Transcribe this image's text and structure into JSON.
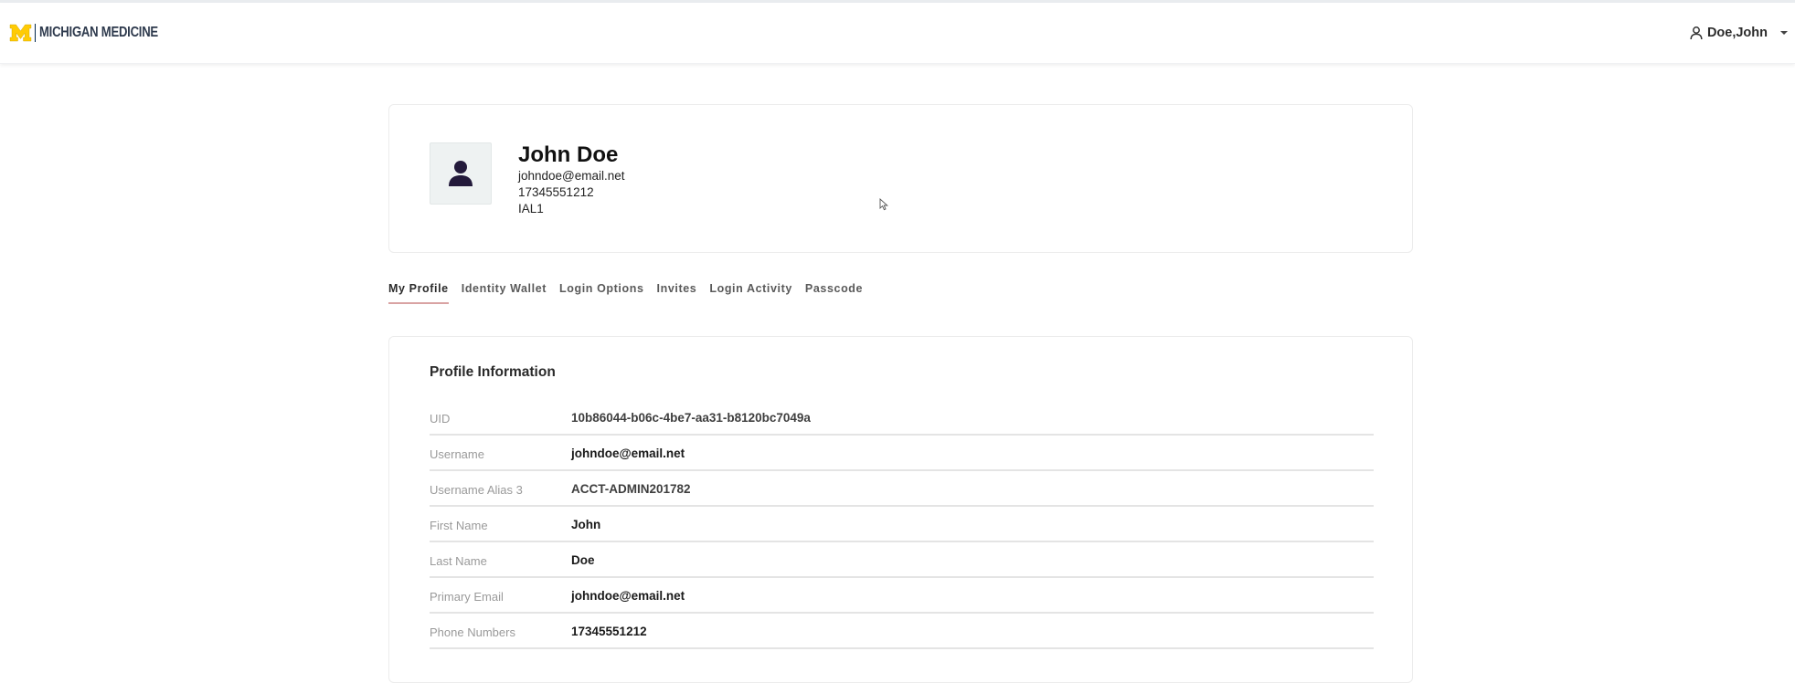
{
  "header": {
    "logo_text": "MICHIGAN MEDICINE",
    "user_name": "Doe,John",
    "colors": {
      "logo_maize": "#FFCB05",
      "logo_blue": "#00274C"
    }
  },
  "profile": {
    "name": "John Doe",
    "email": "johndoe@email.net",
    "phone": "17345551212",
    "ial": "IAL1"
  },
  "tabs": [
    {
      "label": "My Profile",
      "active": true
    },
    {
      "label": "Identity Wallet",
      "active": false
    },
    {
      "label": "Login Options",
      "active": false
    },
    {
      "label": "Invites",
      "active": false
    },
    {
      "label": "Login Activity",
      "active": false
    },
    {
      "label": "Passcode",
      "active": false
    }
  ],
  "profile_info": {
    "title": "Profile Information",
    "rows": [
      {
        "label": "UID",
        "value": "10b86044-b06c-4be7-aa31-b8120bc7049a"
      },
      {
        "label": "Username",
        "value": "johndoe@email.net"
      },
      {
        "label": "Username Alias 3",
        "value": "ACCT-ADMIN201782"
      },
      {
        "label": "First Name",
        "value": "John"
      },
      {
        "label": "Last Name",
        "value": "Doe"
      },
      {
        "label": "Primary Email",
        "value": "johndoe@email.net"
      },
      {
        "label": "Phone Numbers",
        "value": "17345551212"
      }
    ]
  },
  "icons": {
    "logo": "block-m-logo-icon",
    "user": "user-icon",
    "caret": "chevron-down-icon",
    "avatar": "person-avatar-icon",
    "cursor": "mouse-cursor-icon"
  }
}
